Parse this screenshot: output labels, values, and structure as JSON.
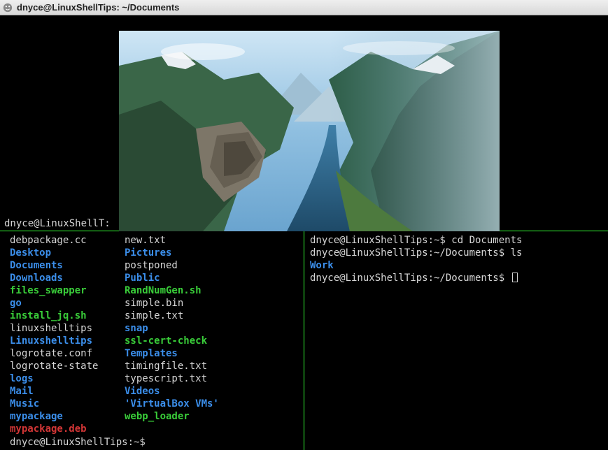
{
  "window": {
    "title": "dnyce@LinuxShellTips: ~/Documents"
  },
  "top_pane": {
    "prompt": "dnyce@LinuxShellT:"
  },
  "left_pane": {
    "rows": [
      {
        "a": {
          "text": "debpackage.cc",
          "cls": "c-white"
        },
        "b": {
          "text": "new.txt",
          "cls": "c-white"
        }
      },
      {
        "a": {
          "text": "Desktop",
          "cls": "c-blue"
        },
        "b": {
          "text": "Pictures",
          "cls": "c-blue"
        }
      },
      {
        "a": {
          "text": "Documents",
          "cls": "c-blue"
        },
        "b": {
          "text": "postponed",
          "cls": "c-white"
        }
      },
      {
        "a": {
          "text": "Downloads",
          "cls": "c-blue"
        },
        "b": {
          "text": "Public",
          "cls": "c-blue"
        }
      },
      {
        "a": {
          "text": "files_swapper",
          "cls": "c-green"
        },
        "b": {
          "text": "RandNumGen.sh",
          "cls": "c-green"
        }
      },
      {
        "a": {
          "text": "go",
          "cls": "c-blue"
        },
        "b": {
          "text": "simple.bin",
          "cls": "c-white"
        }
      },
      {
        "a": {
          "text": "install_jq.sh",
          "cls": "c-green"
        },
        "b": {
          "text": "simple.txt",
          "cls": "c-white"
        }
      },
      {
        "a": {
          "text": "linuxshelltips",
          "cls": "c-white"
        },
        "b": {
          "text": "snap",
          "cls": "c-blue"
        }
      },
      {
        "a": {
          "text": "Linuxshelltips",
          "cls": "c-blue"
        },
        "b": {
          "text": "ssl-cert-check",
          "cls": "c-green"
        }
      },
      {
        "a": {
          "text": "logrotate.conf",
          "cls": "c-white"
        },
        "b": {
          "text": "Templates",
          "cls": "c-blue"
        }
      },
      {
        "a": {
          "text": "logrotate-state",
          "cls": "c-white"
        },
        "b": {
          "text": "timingfile.txt",
          "cls": "c-white"
        }
      },
      {
        "a": {
          "text": "logs",
          "cls": "c-blue"
        },
        "b": {
          "text": "typescript.txt",
          "cls": "c-white"
        }
      },
      {
        "a": {
          "text": "Mail",
          "cls": "c-blue"
        },
        "b": {
          "text": "Videos",
          "cls": "c-blue"
        }
      },
      {
        "a": {
          "text": "Music",
          "cls": "c-blue"
        },
        "b": {
          "text": "'VirtualBox VMs'",
          "cls": "c-blue"
        }
      },
      {
        "a": {
          "text": "mypackage",
          "cls": "c-blue"
        },
        "b": {
          "text": "webp_loader",
          "cls": "c-green"
        }
      },
      {
        "a": {
          "text": "mypackage.deb",
          "cls": "c-red"
        },
        "b": {
          "text": "",
          "cls": "c-white"
        }
      }
    ],
    "prompt": "dnyce@LinuxShellTips:~$ "
  },
  "right_pane": {
    "lines": [
      {
        "segments": [
          {
            "text": "dnyce@LinuxShellTips:~$ ",
            "cls": "c-white"
          },
          {
            "text": "cd Documents",
            "cls": "c-white"
          }
        ]
      },
      {
        "segments": [
          {
            "text": "dnyce@LinuxShellTips:~/Documents$ ",
            "cls": "c-white"
          },
          {
            "text": "ls",
            "cls": "c-white"
          }
        ]
      },
      {
        "segments": [
          {
            "text": "Work",
            "cls": "c-blue"
          }
        ]
      },
      {
        "segments": [
          {
            "text": "dnyce@LinuxShellTips:~/Documents$ ",
            "cls": "c-white"
          }
        ],
        "cursor": true
      }
    ]
  }
}
